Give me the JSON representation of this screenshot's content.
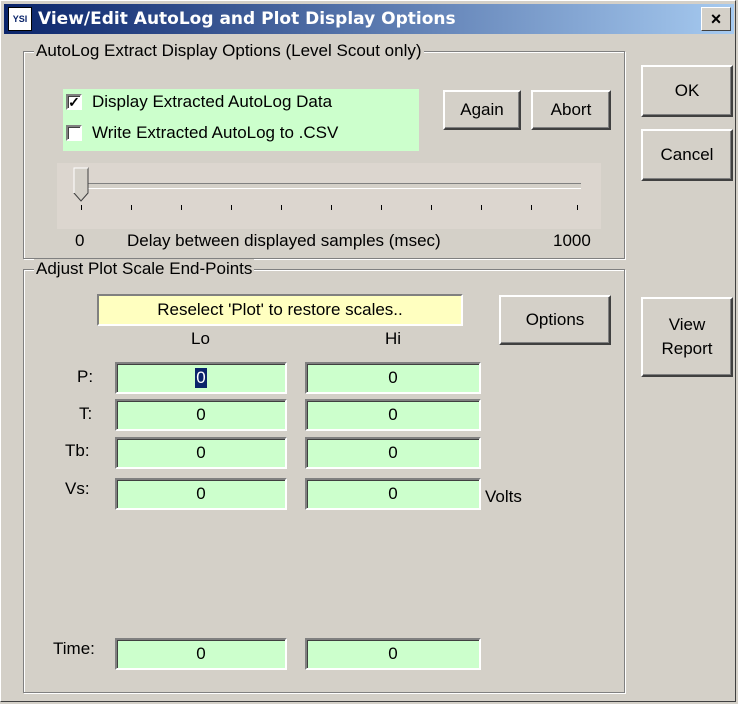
{
  "window": {
    "title": "View/Edit AutoLog and Plot Display Options",
    "icon": "YSI",
    "close_label": "×"
  },
  "dialog_buttons": {
    "ok": "OK",
    "cancel": "Cancel",
    "view_report": "View Report"
  },
  "autolog": {
    "group_label": "AutoLog Extract Display Options (Level Scout only)",
    "display_extracted": {
      "label": "Display Extracted AutoLog Data",
      "checked": true
    },
    "write_csv": {
      "label": "Write Extracted AutoLog to .CSV",
      "checked": false
    },
    "again_label": "Again",
    "abort_label": "Abort",
    "slider": {
      "min_label": "0",
      "max_label": "1000",
      "caption": "Delay between displayed samples (msec)",
      "value": 0
    }
  },
  "plot": {
    "group_label": "Adjust Plot Scale End-Points",
    "note": "Reselect 'Plot' to restore scales..",
    "options_label": "Options",
    "lo_header": "Lo",
    "hi_header": "Hi",
    "rows": [
      {
        "label": "P:",
        "lo": "0",
        "hi": "0",
        "unit": ""
      },
      {
        "label": "T:",
        "lo": "0",
        "hi": "0",
        "unit": ""
      },
      {
        "label": "Tb:",
        "lo": "0",
        "hi": "0",
        "unit": ""
      },
      {
        "label": "Vs:",
        "lo": "0",
        "hi": "0",
        "unit": "Volts"
      }
    ],
    "time": {
      "label": "Time:",
      "lo": "0",
      "hi": "0"
    }
  }
}
